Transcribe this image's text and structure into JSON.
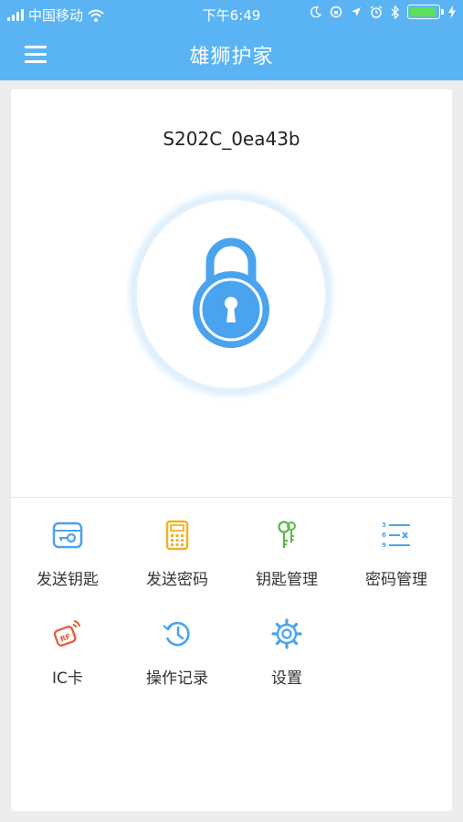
{
  "status_bar": {
    "carrier": "中国移动",
    "time": "下午6:49"
  },
  "nav": {
    "title": "雄狮护家"
  },
  "device": {
    "name": "S202C_0ea43b"
  },
  "colors": {
    "header": "#5ab4f3",
    "lock": "#4aa3ee",
    "send_password_icon": "#f0b228",
    "key_manage_icon": "#5cba47",
    "ic_card_icon": "#e75a3a"
  },
  "actions": [
    {
      "label": "发送钥匙",
      "icon": "send-key-icon"
    },
    {
      "label": "发送密码",
      "icon": "calculator-icon"
    },
    {
      "label": "钥匙管理",
      "icon": "keys-icon"
    },
    {
      "label": "密码管理",
      "icon": "password-list-icon"
    },
    {
      "label": "IC卡",
      "icon": "rf-card-icon"
    },
    {
      "label": "操作记录",
      "icon": "history-icon"
    },
    {
      "label": "设置",
      "icon": "gear-icon"
    }
  ]
}
